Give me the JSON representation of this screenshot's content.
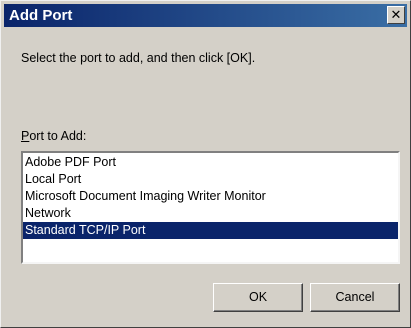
{
  "window": {
    "title": "Add Port",
    "close_glyph": "✕"
  },
  "dialog": {
    "instruction": "Select the port to add, and then click [OK].",
    "list_label_accel": "P",
    "list_label_rest": "ort to Add:"
  },
  "ports": {
    "items": [
      {
        "label": "Adobe PDF Port",
        "selected": false
      },
      {
        "label": "Local Port",
        "selected": false
      },
      {
        "label": "Microsoft Document Imaging Writer Monitor",
        "selected": false
      },
      {
        "label": "Network",
        "selected": false
      },
      {
        "label": "Standard TCP/IP Port",
        "selected": true
      }
    ]
  },
  "buttons": {
    "ok_label": "OK",
    "cancel_label": "Cancel"
  },
  "colors": {
    "titlebar_start": "#0a246a",
    "titlebar_end": "#3a6ea5",
    "selection": "#0a246a",
    "dialog_bg": "#d4d0c8"
  }
}
